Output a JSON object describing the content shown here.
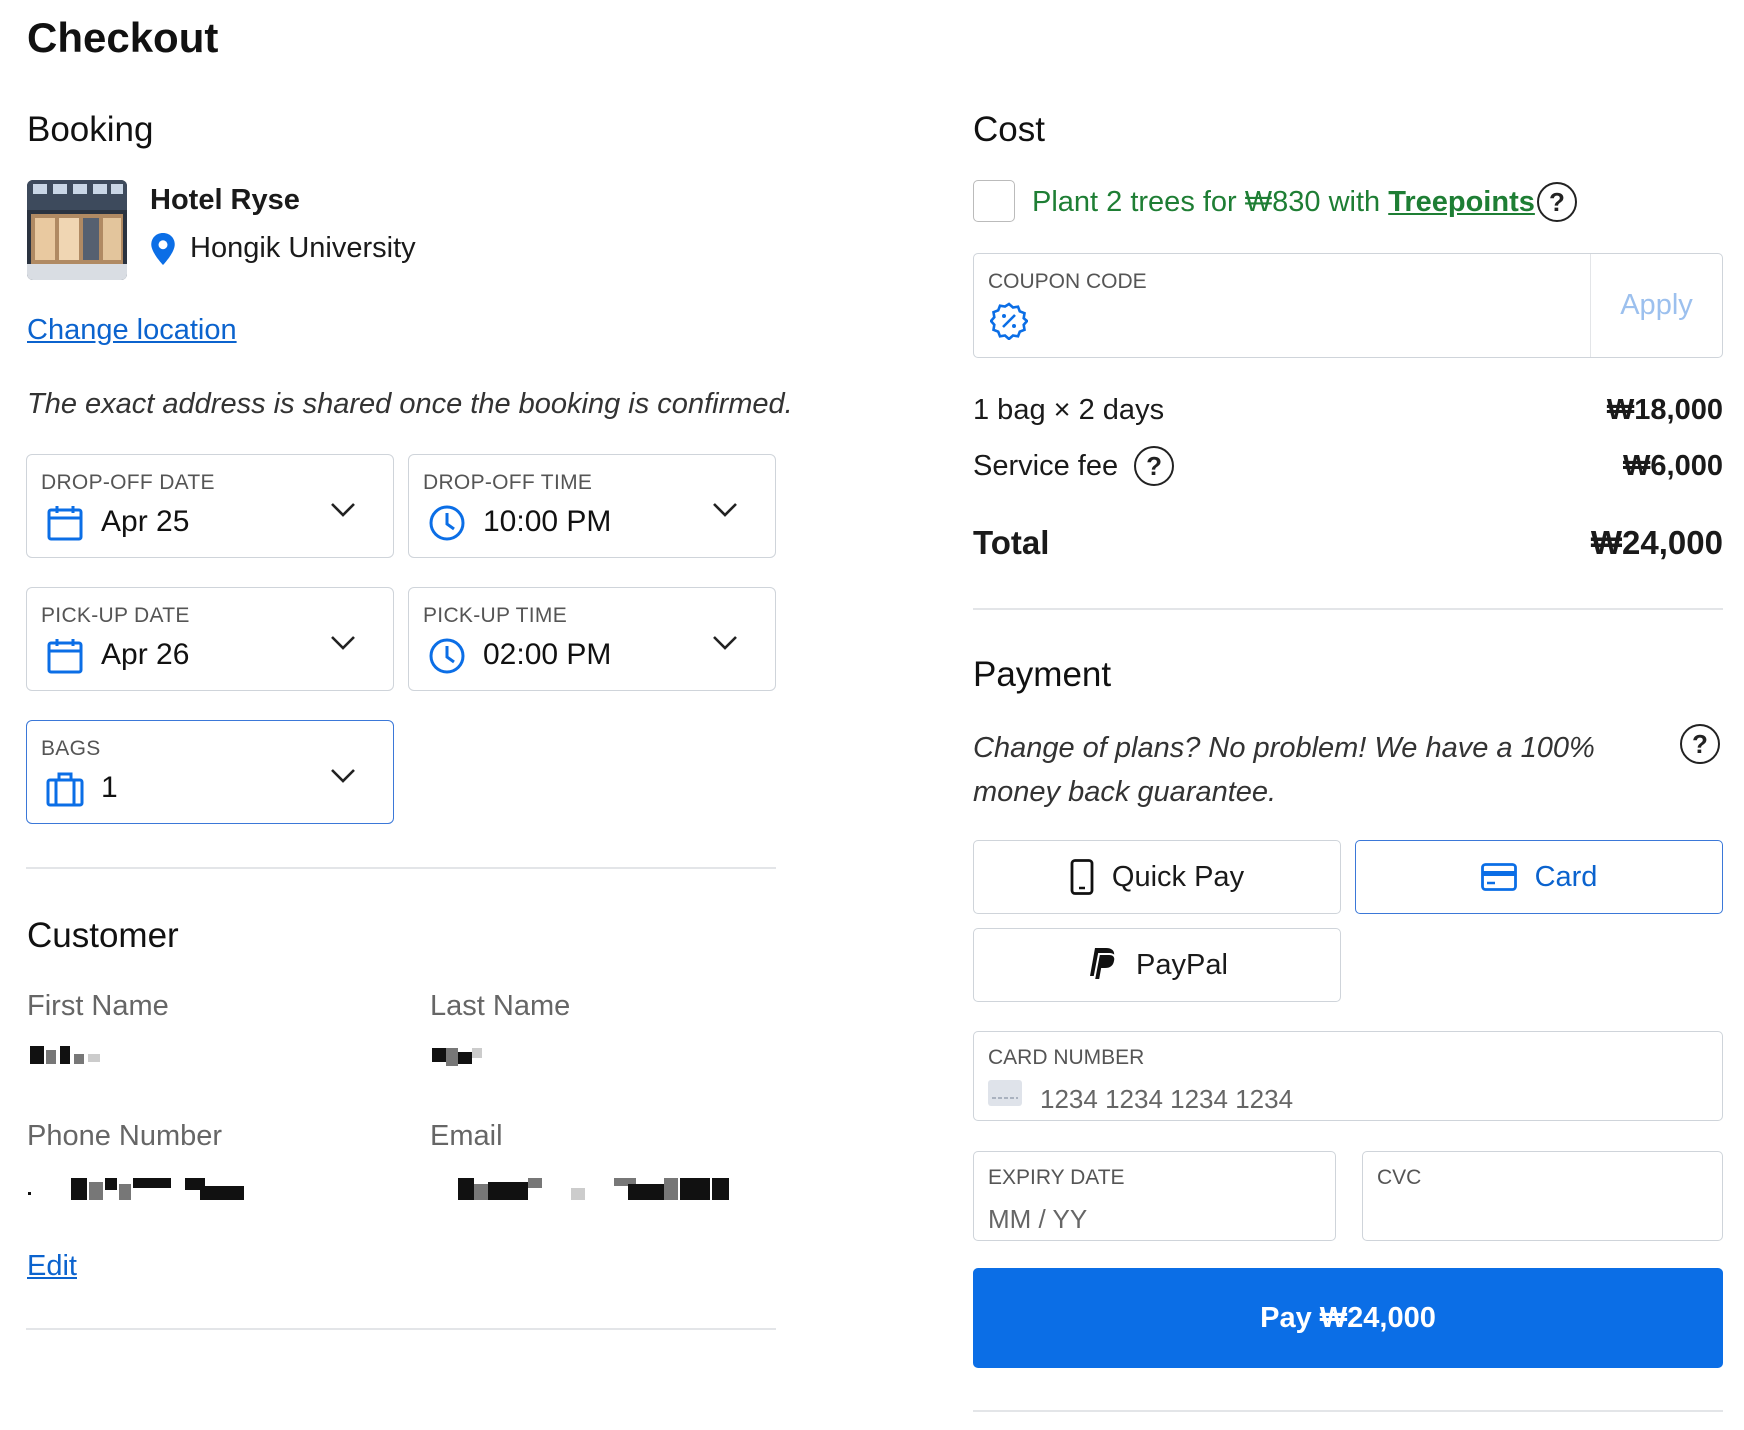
{
  "page_title": "Checkout",
  "booking": {
    "section_title": "Booking",
    "hotel_name": "Hotel Ryse",
    "location": "Hongik University",
    "change_location_label": "Change location",
    "address_note": "The exact address is shared once the booking is confirmed.",
    "dropoff_date": {
      "label": "DROP-OFF DATE",
      "value": "Apr 25",
      "icon": "calendar-icon"
    },
    "dropoff_time": {
      "label": "DROP-OFF TIME",
      "value": "10:00 PM",
      "icon": "clock-icon"
    },
    "pickup_date": {
      "label": "PICK-UP DATE",
      "value": "Apr 26",
      "icon": "calendar-icon"
    },
    "pickup_time": {
      "label": "PICK-UP TIME",
      "value": "02:00 PM",
      "icon": "clock-icon"
    },
    "bags": {
      "label": "BAGS",
      "value": "1",
      "icon": "briefcase-icon"
    }
  },
  "customer": {
    "section_title": "Customer",
    "first_name_label": "First Name",
    "last_name_label": "Last Name",
    "phone_label": "Phone Number",
    "email_label": "Email",
    "edit_label": "Edit"
  },
  "cost": {
    "section_title": "Cost",
    "trees_text": "Plant 2 trees for ₩830 with ",
    "trees_link": "Treepoints",
    "coupon_label": "COUPON CODE",
    "coupon_icon": "discount-badge-icon",
    "apply_label": "Apply",
    "line1_label": "1 bag × 2 days",
    "line1_amount": "₩18,000",
    "service_fee_label": "Service fee",
    "service_fee_amount": "₩6,000",
    "total_label": "Total",
    "total_amount": "₩24,000",
    "help_glyph": "?"
  },
  "payment": {
    "section_title": "Payment",
    "note": "Change of plans? No problem! We have a 100% money back guarantee.",
    "methods": {
      "quick_pay": "Quick Pay",
      "card": "Card",
      "paypal": "PayPal"
    },
    "selected_method": "Card",
    "card_number_label": "CARD NUMBER",
    "card_number_placeholder": "1234 1234 1234 1234",
    "expiry_label": "EXPIRY DATE",
    "expiry_placeholder": "MM / YY",
    "cvc_label": "CVC",
    "pay_button": "Pay ₩24,000"
  },
  "colors": {
    "accent": "#0b6ee6",
    "link": "#0b63ce",
    "green": "#1e7e34"
  }
}
